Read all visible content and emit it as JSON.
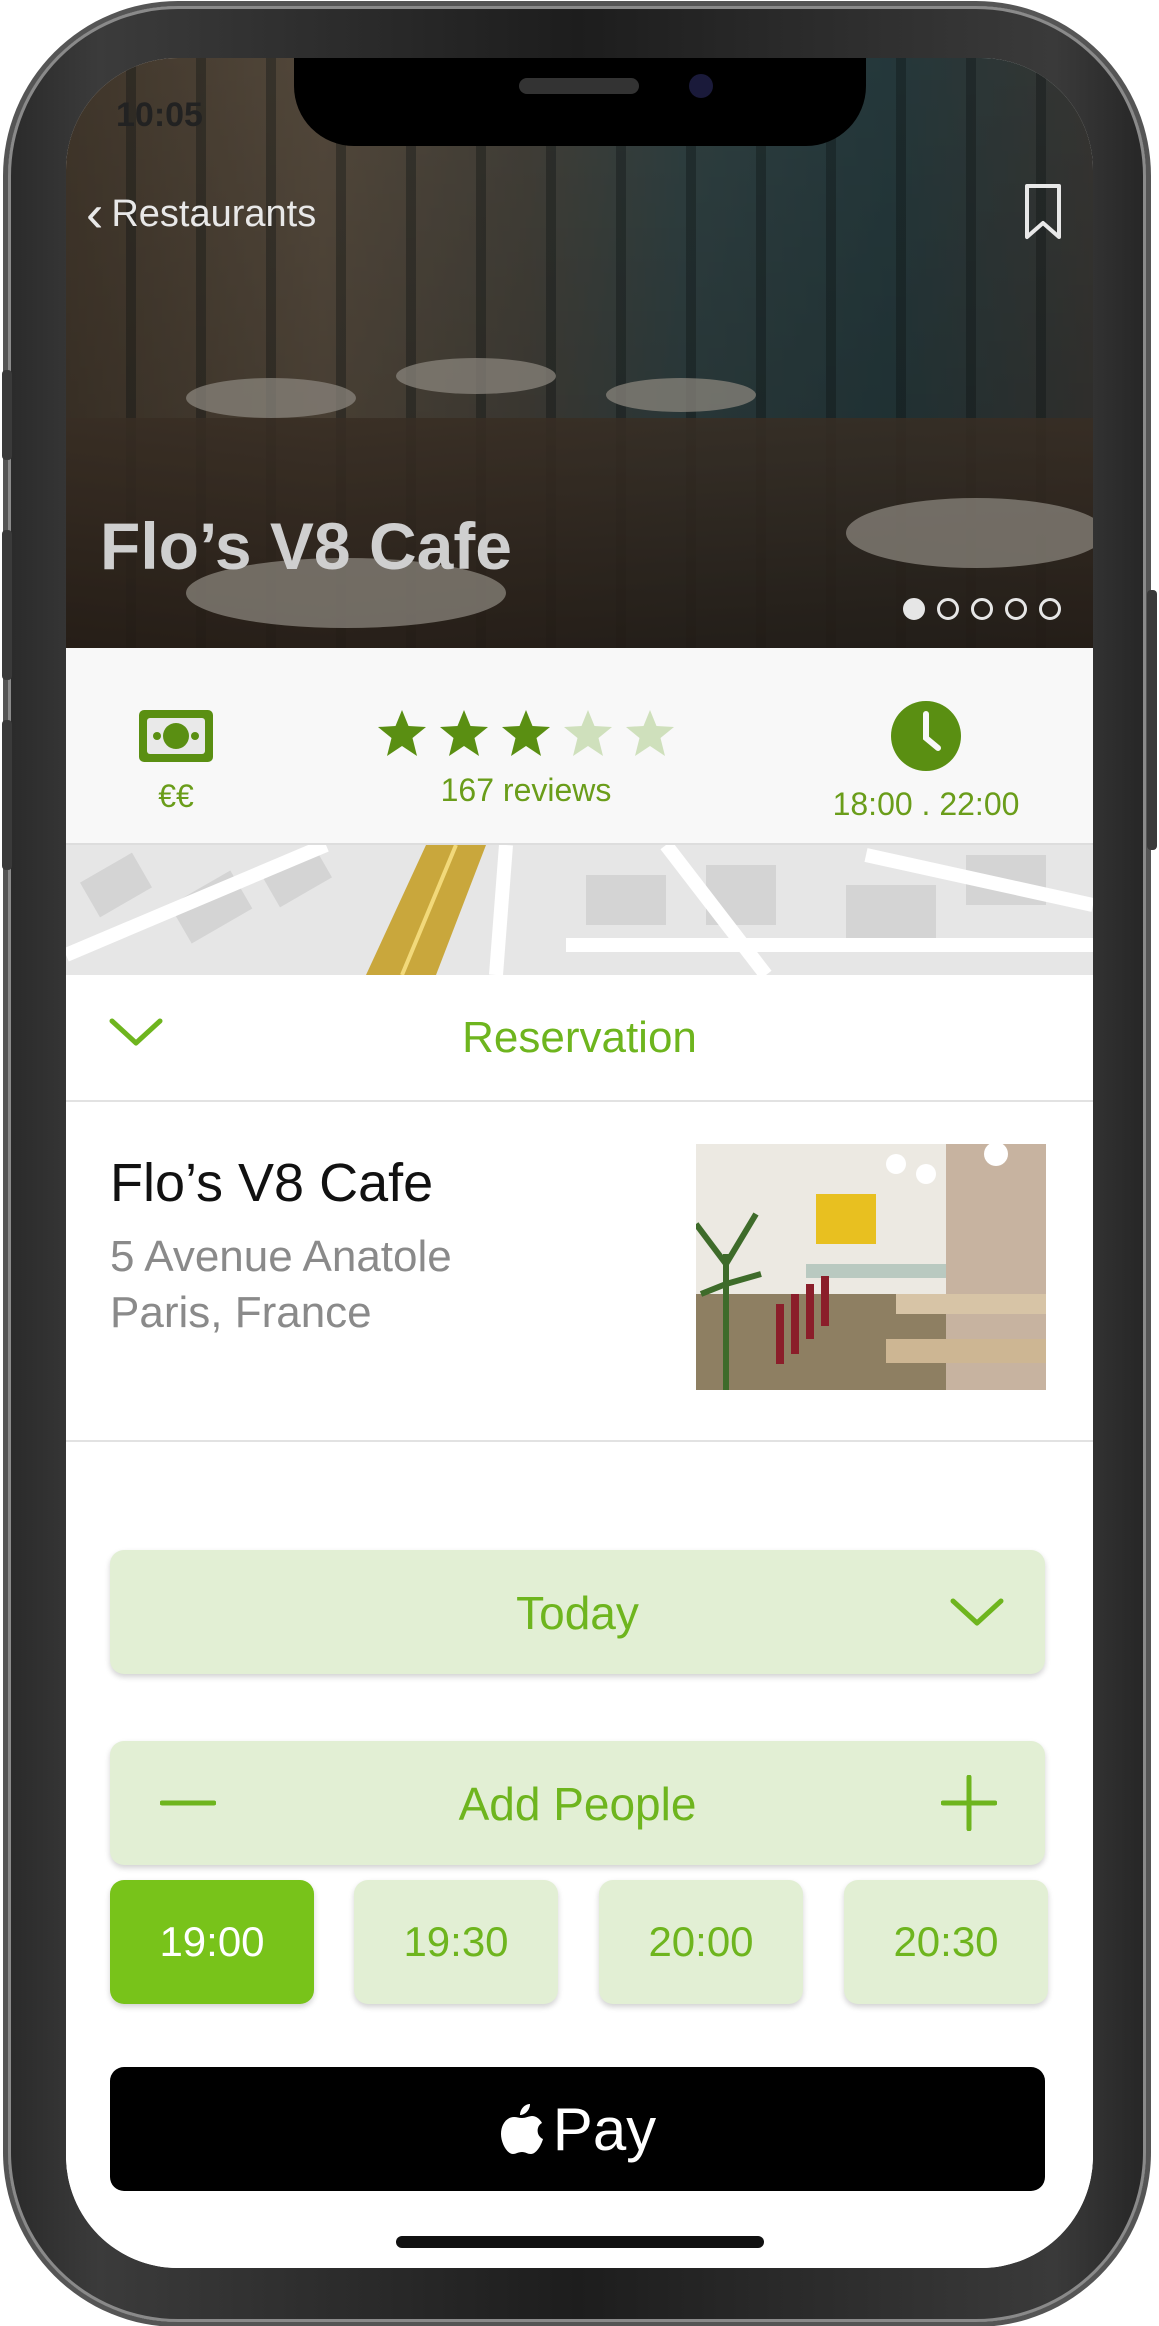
{
  "status_bar": {
    "time": "10:05"
  },
  "nav": {
    "back_label": "Restaurants"
  },
  "hero": {
    "title": "Flo’s V8 Cafe",
    "photo_count": 5,
    "active_photo": 1
  },
  "info": {
    "price": "€€",
    "rating": 3,
    "rating_max": 5,
    "reviews": "167 reviews",
    "hours": "18:00 . 22:00"
  },
  "sheet": {
    "title": "Reservation"
  },
  "restaurant": {
    "name": "Flo’s V8 Cafe",
    "address_line1": "5 Avenue Anatole",
    "address_line2": "Paris, France"
  },
  "date_picker": {
    "value": "Today"
  },
  "people": {
    "label": "Add People"
  },
  "times": [
    {
      "label": "19:00",
      "selected": true
    },
    {
      "label": "19:30",
      "selected": false
    },
    {
      "label": "20:00",
      "selected": false
    },
    {
      "label": "20:30",
      "selected": false
    }
  ],
  "pay_button": {
    "label": "Pay"
  },
  "colors": {
    "accent": "#6eb51e",
    "accent_dark": "#5a8f12",
    "pill_bg": "#e2efd4",
    "selected_bg": "#78c31a"
  }
}
